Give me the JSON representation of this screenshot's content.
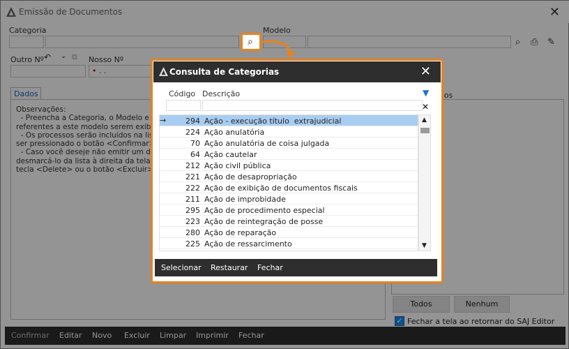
{
  "window": {
    "title": "Emissão de Documentos"
  },
  "form": {
    "categoria_label": "Categoria",
    "modelo_label": "Modelo",
    "outro_label": "Outro Nº",
    "nosso_label": "Nosso Nº",
    "nosso_value": "• . ."
  },
  "tabs": {
    "dados": "Dados"
  },
  "observacoes": "Observações:\n  - Preencha a Categoria, o Modelo e o\nreferentes a este modelo serem exibid\n  - Os processos serão incluídos na list\nser pressionado o botão <Confirmar>\n  - Caso você deseje não emitir um do\ndesmarcá-lo da lista à direita da tela,\ntecla <Delete> ou o botão <Excluir>",
  "right_panel": {
    "label": "sos"
  },
  "buttons": {
    "todos": "Todos",
    "nenhum": "Nenhum"
  },
  "checkbox": {
    "label": "Fechar a tela ao retornar do SAJ Editor",
    "checked": true
  },
  "bottom_bar": [
    "Confirmar",
    "Editar",
    "Novo",
    "Excluir",
    "Limpar",
    "Imprimir",
    "Fechar"
  ],
  "dialog": {
    "title": "Consulta de Categorias",
    "columns": {
      "codigo": "Código",
      "descricao": "Descrição"
    },
    "rows": [
      {
        "cod": "294",
        "desc": "Ação - execução título  extrajudicial",
        "selected": true
      },
      {
        "cod": "224",
        "desc": "Ação anulatória"
      },
      {
        "cod": "70",
        "desc": "Ação anulatória de coisa julgada"
      },
      {
        "cod": "64",
        "desc": "Ação cautelar"
      },
      {
        "cod": "212",
        "desc": "Ação civil pública"
      },
      {
        "cod": "221",
        "desc": "Ação de desapropriação"
      },
      {
        "cod": "222",
        "desc": "Ação de exibição de documentos fiscais"
      },
      {
        "cod": "211",
        "desc": "Ação de improbidade"
      },
      {
        "cod": "295",
        "desc": "Ação de procedimento especial"
      },
      {
        "cod": "223",
        "desc": "Ação de reintegração de posse"
      },
      {
        "cod": "280",
        "desc": "Ação de reparação"
      },
      {
        "cod": "225",
        "desc": "Ação de ressarcimento"
      }
    ],
    "actions": [
      "Selecionar",
      "Restaurar",
      "Fechar"
    ]
  },
  "colors": {
    "highlight": "#e8821e",
    "selection": "#a9cdf1",
    "dark_bar": "#2e2e2e"
  }
}
